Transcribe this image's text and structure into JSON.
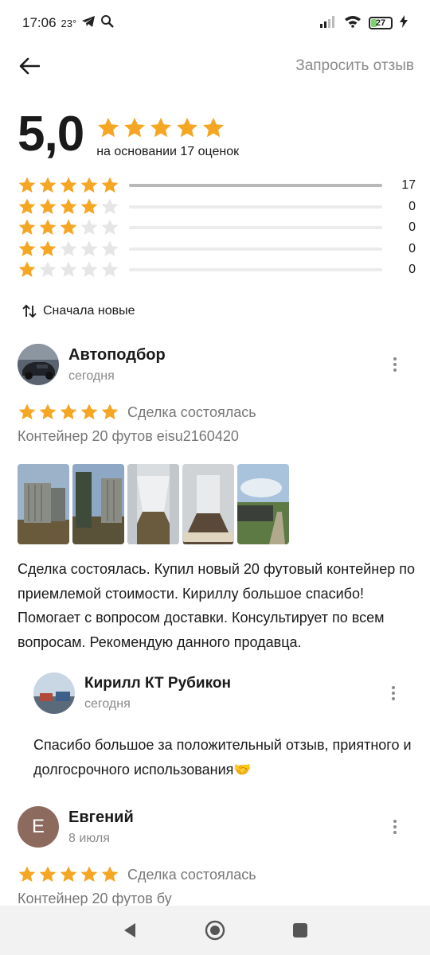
{
  "status_bar": {
    "time": "17:06",
    "temperature": "23°",
    "battery": "27"
  },
  "header": {
    "request_review": "Запросить отзыв"
  },
  "summary": {
    "rating": "5,0",
    "stars": 5,
    "based_on": "на основании 17 оценок"
  },
  "distribution": [
    {
      "stars": 5,
      "count": "17",
      "fraction": 1.0
    },
    {
      "stars": 4,
      "count": "0",
      "fraction": 0
    },
    {
      "stars": 3,
      "count": "0",
      "fraction": 0
    },
    {
      "stars": 2,
      "count": "0",
      "fraction": 0
    },
    {
      "stars": 1,
      "count": "0",
      "fraction": 0
    }
  ],
  "sort": {
    "label": "Сначала новые"
  },
  "reviews": [
    {
      "name": "Автоподбор",
      "date": "сегодня",
      "stars": 5,
      "deal": "Сделка состоялась",
      "item": "Контейнер 20 футов eisu2160420",
      "text": "Сделка состоялась. Купил новый 20 футовый контейнер по приемлемой стоимости. Кириллу большое спасибо! Помогает с вопросом доставки. Консультирует по всем вопросам. Рекомендую данного продавца.",
      "reply": {
        "name": "Кирилл КТ Рубикон",
        "date": "сегодня",
        "text": "Спасибо большое за положительный отзыв, приятного и долгосрочного использования🤝"
      }
    },
    {
      "avatar_letter": "Е",
      "name": "Евгений",
      "date": "8 июля",
      "stars": 5,
      "deal": "Сделка состоялась",
      "item": "Контейнер 20 футов бу"
    }
  ],
  "colors": {
    "star": "#f5a623",
    "star_empty": "#e6e6e6",
    "muted": "#8a8a8a"
  }
}
